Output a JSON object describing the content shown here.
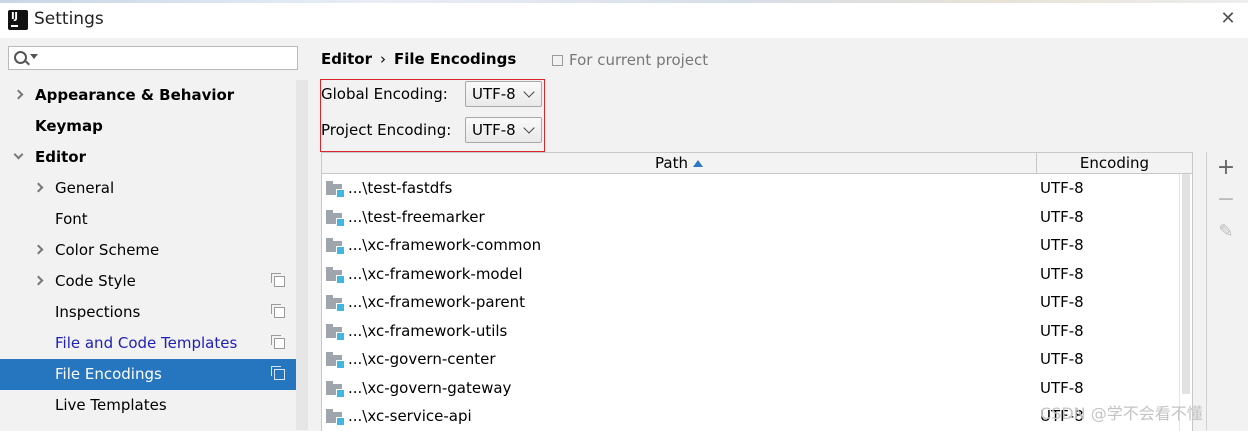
{
  "window": {
    "title": "Settings",
    "close_icon": "close-icon"
  },
  "search": {
    "value": "",
    "placeholder": ""
  },
  "sidebar": {
    "items": [
      {
        "label": "Appearance & Behavior",
        "arrow": "right",
        "bold": true
      },
      {
        "label": "Keymap",
        "arrow": "",
        "bold": true
      },
      {
        "label": "Editor",
        "arrow": "down",
        "bold": true
      },
      {
        "label": "General",
        "arrow": "right"
      },
      {
        "label": "Font",
        "arrow": ""
      },
      {
        "label": "Color Scheme",
        "arrow": "right"
      },
      {
        "label": "Code Style",
        "arrow": "right",
        "project_icon": true
      },
      {
        "label": "Inspections",
        "arrow": "",
        "project_icon": true
      },
      {
        "label": "File and Code Templates",
        "arrow": "",
        "project_icon": true,
        "link": true
      },
      {
        "label": "File Encodings",
        "arrow": "",
        "project_icon": true,
        "selected": true
      },
      {
        "label": "Live Templates",
        "arrow": ""
      }
    ]
  },
  "breadcrumb": {
    "parent": "Editor",
    "separator": "›",
    "current": "File Encodings",
    "for_current_project": "For current project"
  },
  "encoding": {
    "global_label": "Global Encoding:",
    "global_value": "UTF-8",
    "project_label": "Project Encoding:",
    "project_value": "UTF-8"
  },
  "table": {
    "columns": [
      "Path",
      "Encoding"
    ],
    "rows": [
      {
        "path": "...\\test-fastdfs",
        "encoding": "UTF-8"
      },
      {
        "path": "...\\test-freemarker",
        "encoding": "UTF-8"
      },
      {
        "path": "...\\xc-framework-common",
        "encoding": "UTF-8"
      },
      {
        "path": "...\\xc-framework-model",
        "encoding": "UTF-8"
      },
      {
        "path": "...\\xc-framework-parent",
        "encoding": "UTF-8"
      },
      {
        "path": "...\\xc-framework-utils",
        "encoding": "UTF-8"
      },
      {
        "path": "...\\xc-govern-center",
        "encoding": "UTF-8"
      },
      {
        "path": "...\\xc-govern-gateway",
        "encoding": "UTF-8"
      },
      {
        "path": "...\\xc-service-api",
        "encoding": "UTF-8"
      }
    ]
  },
  "tools": {
    "add": "+",
    "remove": "−",
    "edit": "✎"
  },
  "watermark": "CSDN @学不会看不懂",
  "colors": {
    "selection": "#2675bf",
    "highlight_box": "#d9252b",
    "link": "#2020b8"
  }
}
